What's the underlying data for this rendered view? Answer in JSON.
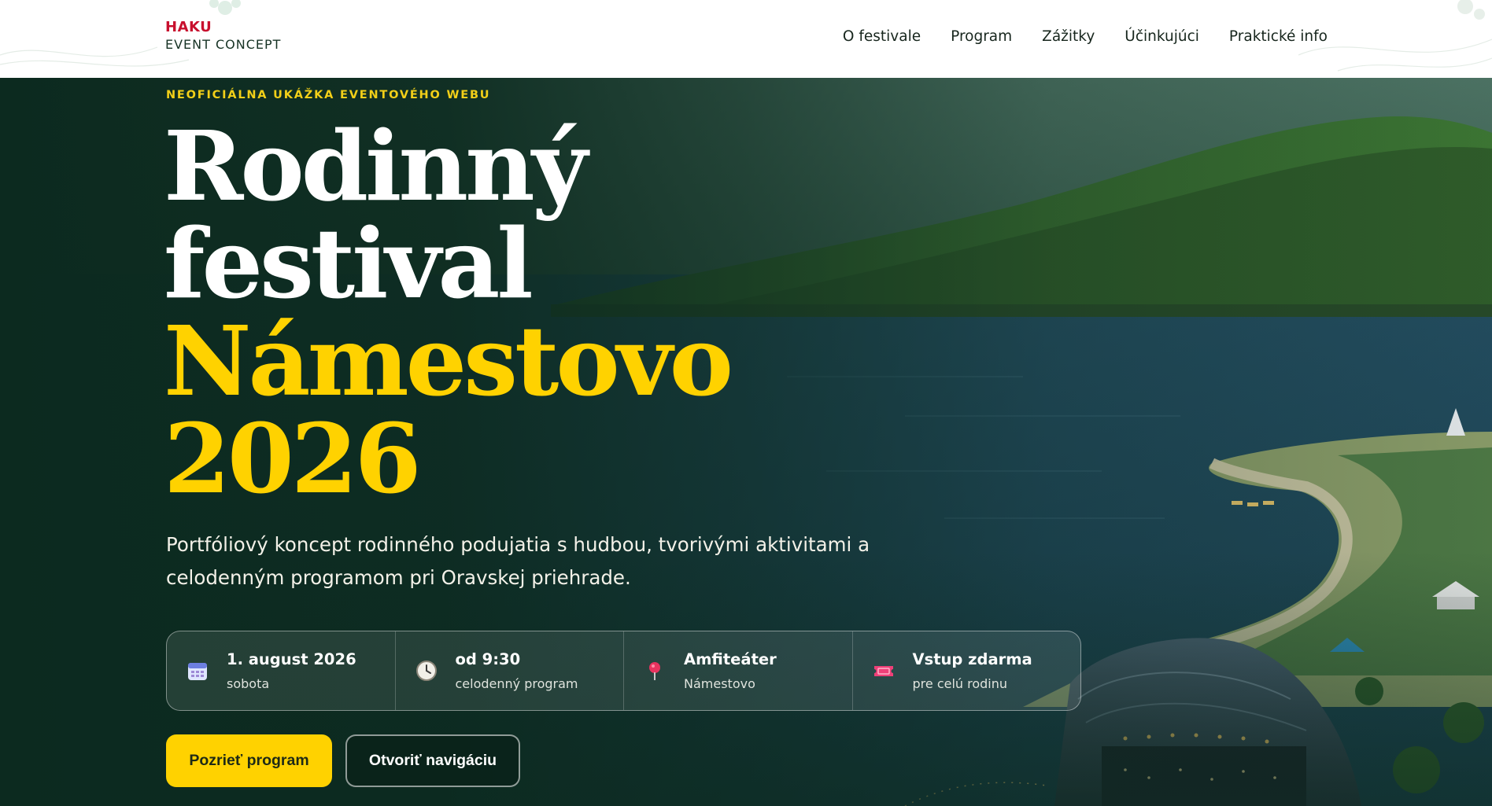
{
  "brand": {
    "top": "HAKU",
    "bottom": "EVENT CONCEPT"
  },
  "nav": [
    {
      "label": "O festivale"
    },
    {
      "label": "Program"
    },
    {
      "label": "Zážitky"
    },
    {
      "label": "Účinkujúci"
    },
    {
      "label": "Praktické info"
    }
  ],
  "hero": {
    "eyebrow": "NEOFICIÁLNA UKÁŽKA EVENTOVÉHO WEBU",
    "title_line1": "Rodinný",
    "title_line2": "festival",
    "title_line3": "Námestovo",
    "title_line4": "2026",
    "lead": "Portfóliový koncept rodinného podujatia s hudbou, tvorivými aktivitami a celodenným programom pri Oravskej priehrade."
  },
  "info": [
    {
      "icon": "calendar-icon",
      "main": "1. august 2026",
      "sub": "sobota"
    },
    {
      "icon": "clock-icon",
      "main": "od 9:30",
      "sub": "celodenný program"
    },
    {
      "icon": "location-pin-icon",
      "main": "Amfiteáter",
      "sub": "Námestovo"
    },
    {
      "icon": "ticket-icon",
      "main": "Vstup zdarma",
      "sub": "pre celú rodinu"
    }
  ],
  "buttons": {
    "primary": "Pozrieť program",
    "secondary": "Otvoriť navigáciu"
  },
  "colors": {
    "accent_yellow": "#ffd200",
    "brand_red": "#c8102e",
    "dark_green": "#0f2a1f"
  }
}
